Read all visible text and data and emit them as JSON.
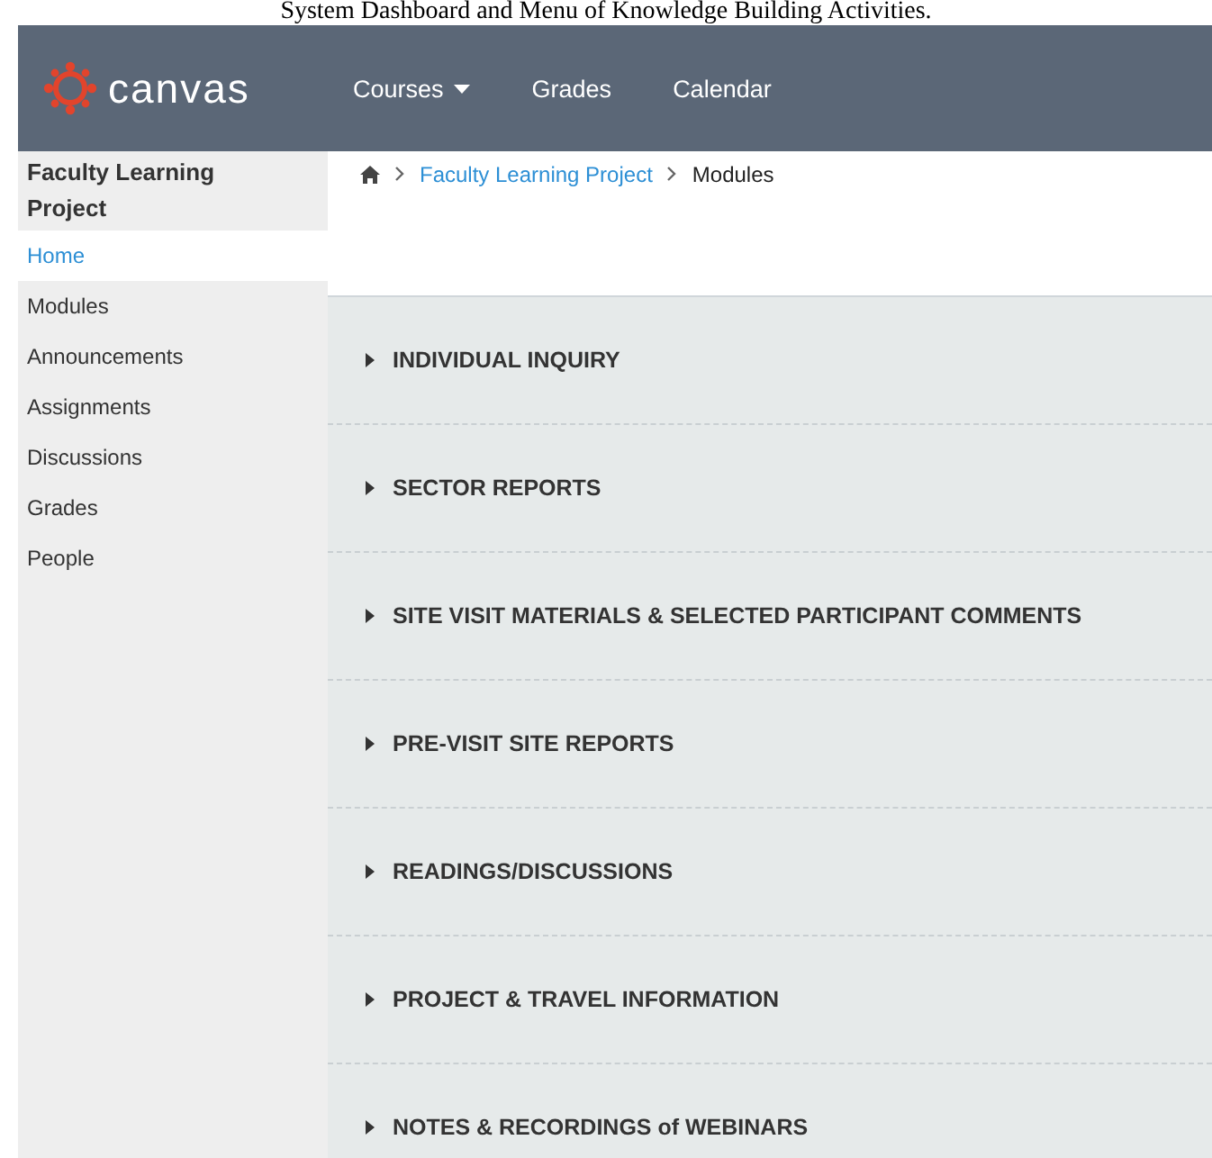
{
  "caption": "System Dashboard and Menu of Knowledge Building Activities.",
  "header": {
    "logo": "canvas",
    "nav": [
      {
        "label": "Courses",
        "dropdown": true
      },
      {
        "label": "Grades",
        "dropdown": false
      },
      {
        "label": "Calendar",
        "dropdown": false
      }
    ]
  },
  "sidebar": {
    "course_title": "Faculty Learning Project",
    "items": [
      {
        "label": "Home",
        "selected": true
      },
      {
        "label": "Modules",
        "selected": false
      },
      {
        "label": "Announcements",
        "selected": false
      },
      {
        "label": "Assignments",
        "selected": false
      },
      {
        "label": "Discussions",
        "selected": false
      },
      {
        "label": "Grades",
        "selected": false
      },
      {
        "label": "People",
        "selected": false
      }
    ]
  },
  "breadcrumb": [
    {
      "label": "Faculty Learning Project",
      "link": true
    },
    {
      "label": "Modules",
      "link": false
    }
  ],
  "modules": [
    {
      "title": "INDIVIDUAL INQUIRY",
      "expanded": false
    },
    {
      "title": "SECTOR REPORTS",
      "expanded": false
    },
    {
      "title": "SITE VISIT MATERIALS & SELECTED PARTICIPANT COMMENTS",
      "expanded": false
    },
    {
      "title": "PRE-VISIT SITE REPORTS",
      "expanded": false
    },
    {
      "title": "READINGS/DISCUSSIONS",
      "expanded": false
    },
    {
      "title": "PROJECT & TRAVEL INFORMATION",
      "expanded": false
    },
    {
      "title": "NOTES & RECORDINGS of WEBINARS",
      "expanded": false
    }
  ]
}
